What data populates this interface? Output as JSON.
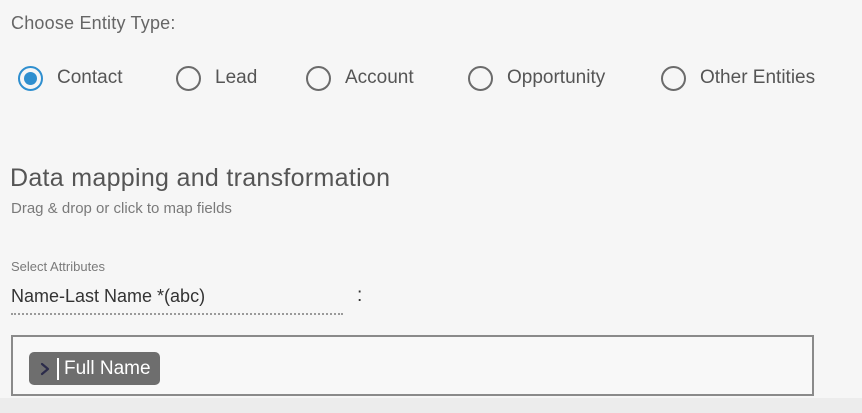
{
  "entity_type": {
    "title": "Choose Entity Type:",
    "options": [
      {
        "label": "Contact",
        "checked": true
      },
      {
        "label": "Lead",
        "checked": false
      },
      {
        "label": "Account",
        "checked": false
      },
      {
        "label": "Opportunity",
        "checked": false
      },
      {
        "label": "Other Entities",
        "checked": false
      }
    ]
  },
  "mapping": {
    "title": "Data mapping and transformation",
    "subtitle": "Drag & drop or click to map fields",
    "select_label": "Select Attributes",
    "attribute_value": "Name-Last Name *(abc)",
    "separator": ":",
    "chip": {
      "icon": "caret-right-icon",
      "label": "Full Name"
    }
  },
  "colors": {
    "accent": "#2f8fcf",
    "chip_bg": "#6e6e6e"
  }
}
